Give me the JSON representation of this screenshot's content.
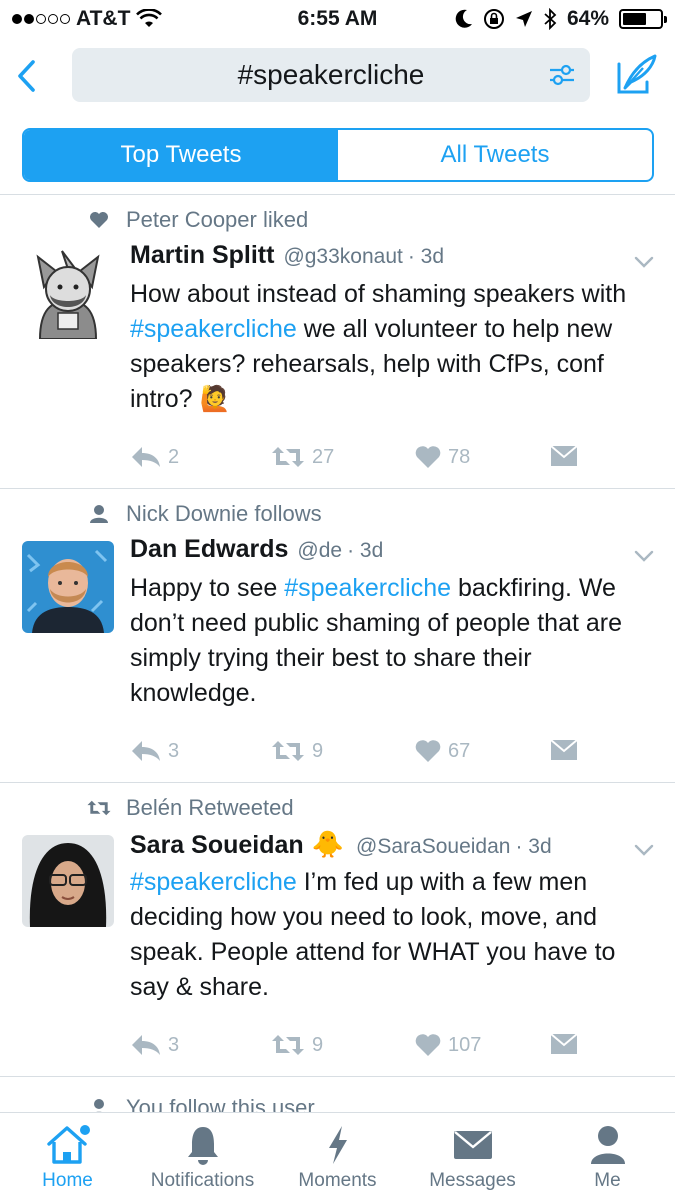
{
  "status_bar": {
    "carrier": "AT&T",
    "time": "6:55 AM",
    "battery": "64%",
    "battery_level": 0.64
  },
  "search": {
    "query": "#speakercliche"
  },
  "segments": {
    "top": "Top Tweets",
    "all": "All Tweets",
    "selected": "Top Tweets"
  },
  "tweets": [
    {
      "context": "Peter Cooper liked",
      "context_icon": "heart-icon",
      "name": "Martin Splitt",
      "handle": "@g33konaut",
      "time": "· 3d",
      "body_parts": [
        {
          "text": "How about instead of shaming speakers with ",
          "hashtag": false
        },
        {
          "text": "#speakercliche",
          "hashtag": true
        },
        {
          "text": " we all volunteer to help new speakers? rehearsals, help with CfPs, conf intro? 🙋",
          "hashtag": false
        }
      ],
      "replies": "2",
      "retweets": "27",
      "likes": "78"
    },
    {
      "context": "Nick Downie follows",
      "context_icon": "person-icon",
      "name": "Dan Edwards",
      "handle": "@de",
      "time": "· 3d",
      "body_parts": [
        {
          "text": "Happy to see ",
          "hashtag": false
        },
        {
          "text": "#speakercliche",
          "hashtag": true
        },
        {
          "text": " backfiring. We don’t need public shaming of people that are simply trying their best to share their knowledge.",
          "hashtag": false
        }
      ],
      "replies": "3",
      "retweets": "9",
      "likes": "67"
    },
    {
      "context": "Belén Retweeted",
      "context_icon": "retweet-icon",
      "name": "Sara Soueidan",
      "name_emoji": "🐥",
      "handle": "@SaraSoueidan",
      "time": "· 3d",
      "body_parts": [
        {
          "text": "#speakercliche",
          "hashtag": true
        },
        {
          "text": " I’m fed up with a few men deciding how you need to look, move, and speak. People attend for WHAT you have to say & share.",
          "hashtag": false
        }
      ],
      "replies": "3",
      "retweets": "9",
      "likes": "107"
    }
  ],
  "partial_context": "You follow this user",
  "tabbar": {
    "home": "Home",
    "notifications": "Notifications",
    "moments": "Moments",
    "messages": "Messages",
    "me": "Me"
  },
  "colors": {
    "accent": "#1da1f2",
    "secondary_text": "#657786",
    "action_gray": "#aab8c2",
    "divider": "#d8dee3"
  }
}
